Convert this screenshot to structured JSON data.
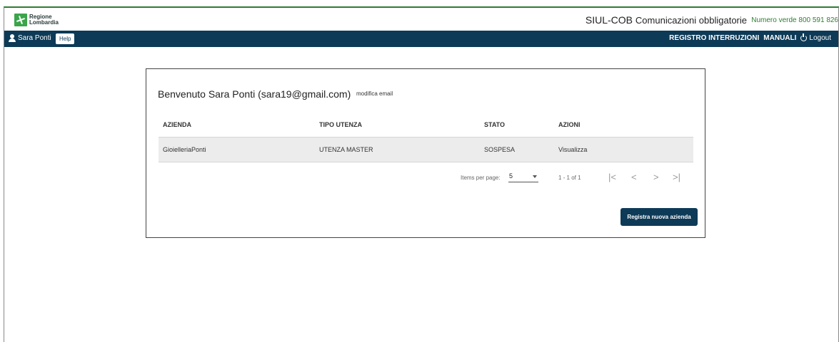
{
  "header": {
    "logo_line1": "Regione",
    "logo_line2": "Lombardia",
    "app_title": "SIUL-COB",
    "app_subtitle": "Comunicazioni obbligatorie",
    "toll_free": "Numero verde 800 591 826"
  },
  "navbar": {
    "user_name": "Sara Ponti",
    "help_label": "Help",
    "links": [
      "REGISTRO INTERRUZIONI",
      "MANUALI"
    ],
    "logout_label": "Logout"
  },
  "card": {
    "welcome": "Benvenuto Sara Ponti (sara19@gmail.com)",
    "edit_email": "modifica email",
    "columns": [
      "AZIENDA",
      "TIPO UTENZA",
      "STATO",
      "AZIONI"
    ],
    "rows": [
      {
        "azienda": "GioielleriaPonti",
        "tipo": "UTENZA MASTER",
        "stato": "SOSPESA",
        "azione": "Visualizza"
      }
    ],
    "paginator": {
      "items_label": "Items per page:",
      "page_size": "5",
      "range": "1 - 1 of 1",
      "first": "|<",
      "prev": "<",
      "next": ">",
      "last": ">|"
    },
    "register_button": "Registra nuova azienda"
  },
  "colors": {
    "navbar": "#0d3a57",
    "accent_green": "#2e7d32",
    "row_bg": "#ececec"
  }
}
